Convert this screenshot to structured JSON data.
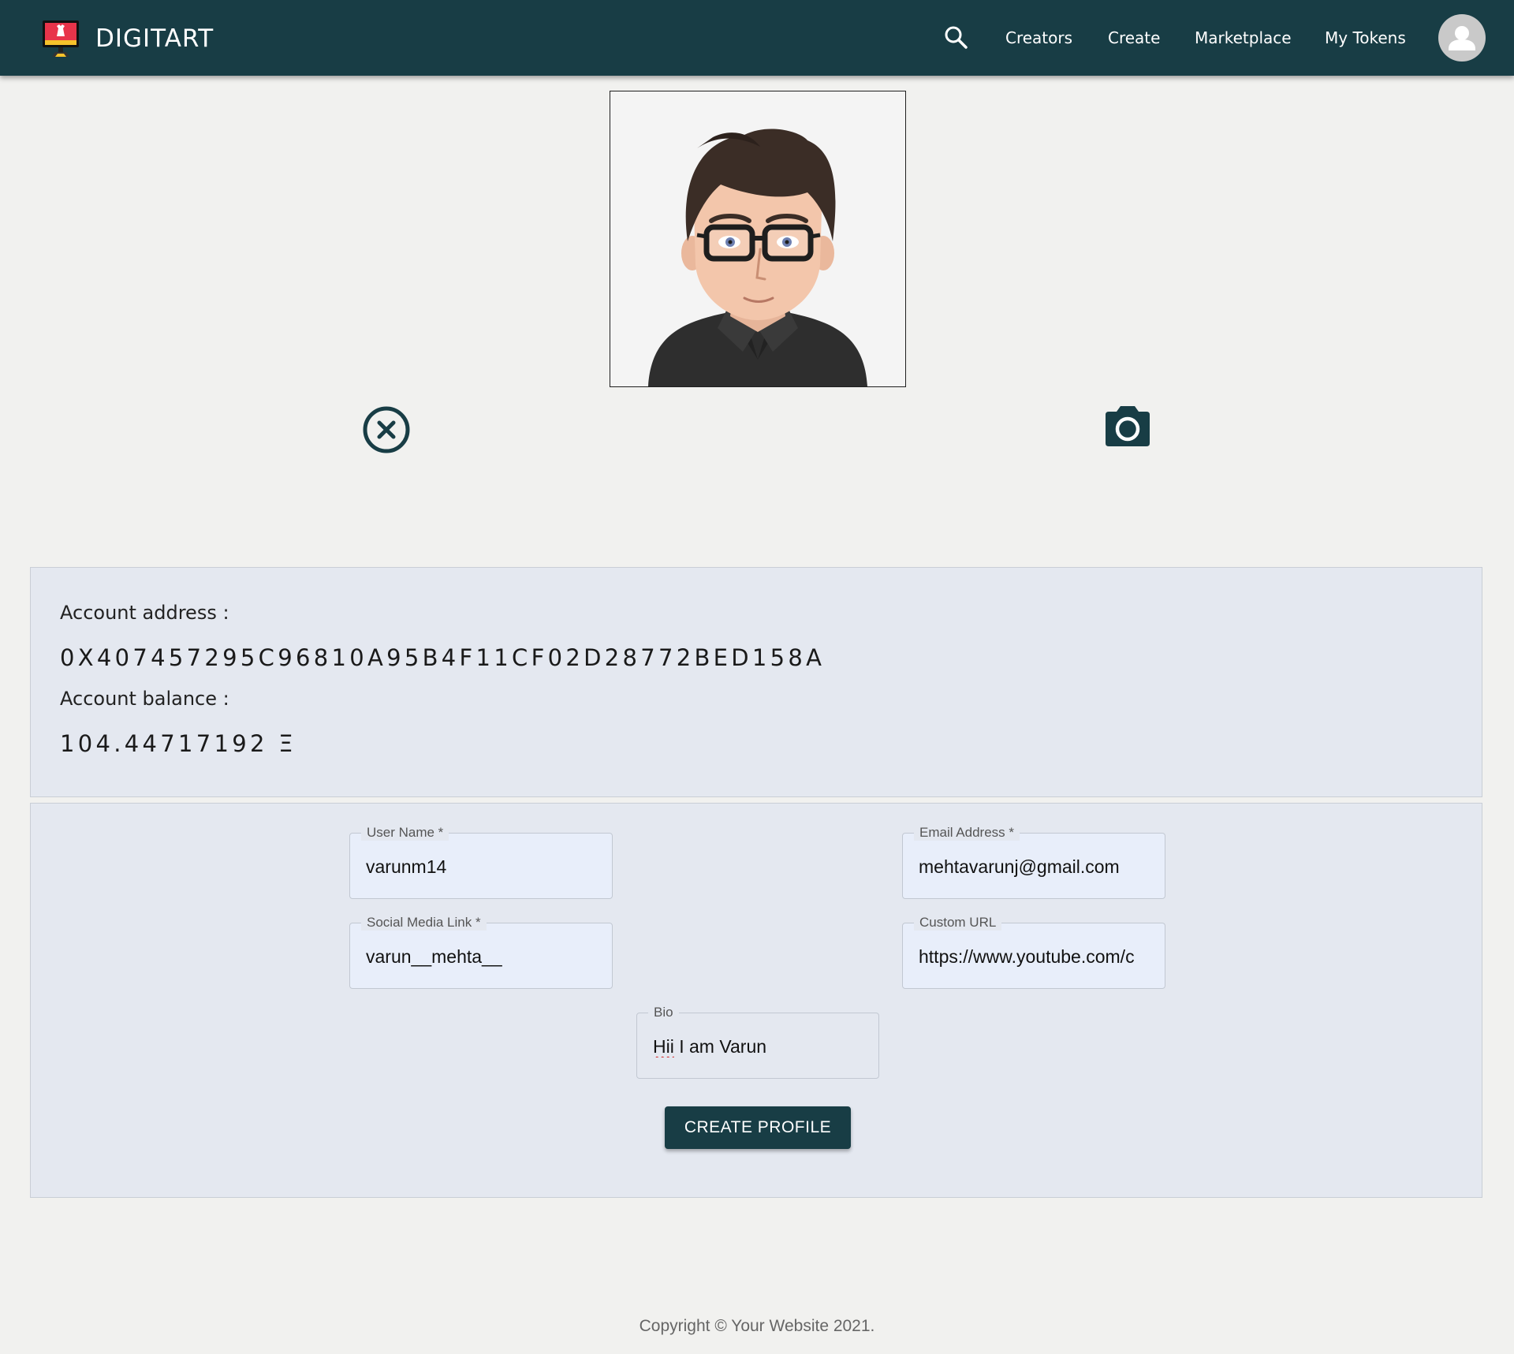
{
  "nav": {
    "brand": "DIGITART",
    "links": [
      "Creators",
      "Create",
      "Marketplace",
      "My Tokens"
    ]
  },
  "account": {
    "address_label": "Account address :",
    "address": "0X407457295C96810A95B4F11CF02D28772BED158A",
    "balance_label": "Account balance :",
    "balance": "104.44717192 Ξ"
  },
  "form": {
    "username": {
      "label": "User Name *",
      "value": "varunm14"
    },
    "email": {
      "label": "Email Address *",
      "value": "mehtavarunj@gmail.com"
    },
    "social": {
      "label": "Social Media Link *",
      "value": "varun__mehta__"
    },
    "custom_url": {
      "label": "Custom URL",
      "value": "https://www.youtube.com/c"
    },
    "bio": {
      "label": "Bio",
      "value_prefix": "Hii",
      "value_rest": " I am Varun"
    },
    "submit_label": "CREATE PROFILE"
  },
  "footer": {
    "text": "Copyright © Your Website 2021."
  },
  "colors": {
    "nav_bg": "#183d45",
    "page_bg": "#f1f1ef",
    "panel_bg": "#e4e8f0",
    "input_bg": "#e8eefa"
  },
  "icons": {
    "logo": "monitor-logo-icon",
    "search": "search-icon",
    "avatar": "user-avatar-icon",
    "remove": "close-circle-icon",
    "camera": "camera-icon"
  }
}
